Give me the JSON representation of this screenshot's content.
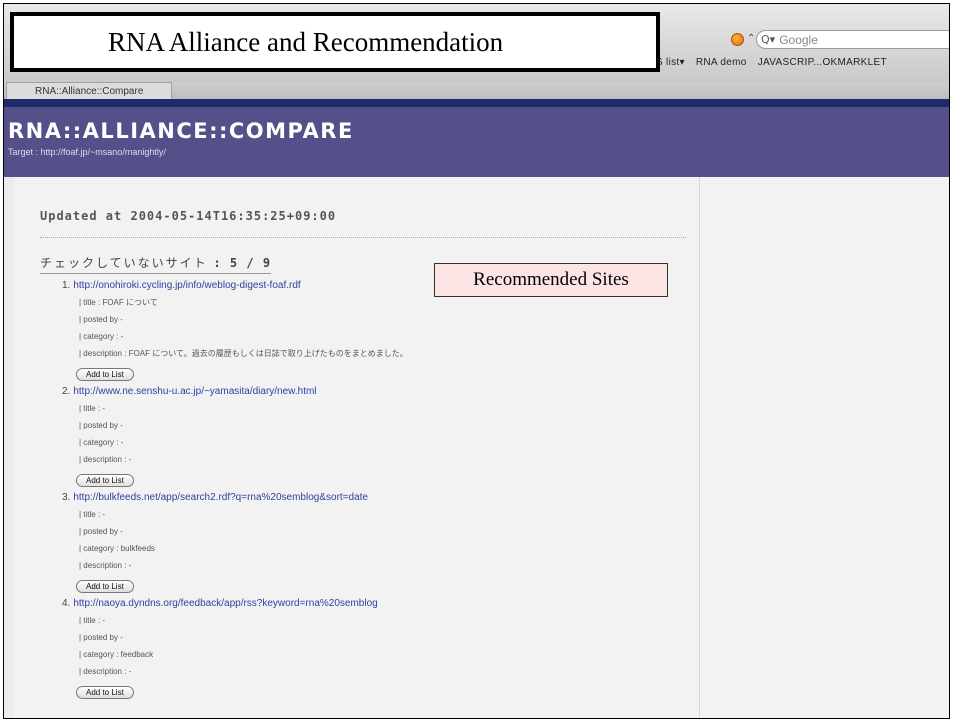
{
  "annotation": {
    "title": "RNA Alliance and Recommendation",
    "recommended": "Recommended Sites"
  },
  "browser": {
    "search_placeholder": "Google",
    "bookmarks": [
      "S list▾",
      "RNA demo",
      "JAVASCRIP...OKMARKLET"
    ],
    "tab_title": "RNA::Alliance::Compare"
  },
  "header": {
    "title": "RNA::ALLIANCE::COMPARE",
    "target": "Target : http://foaf.jp/~msano/manightly/"
  },
  "main": {
    "updated": "Updated at 2004-05-14T16:35:25+09:00",
    "unchecked_label": "チェックしていないサイト",
    "unchecked_count": ": 5 / 9",
    "add_label": "Add to List",
    "entries": [
      {
        "num": "1.",
        "url": "http://onohiroki.cycling.jp/info/weblog-digest-foaf.rdf",
        "title": "| title : FOAF について",
        "posted": "| posted by -",
        "category": "| category : -",
        "description": "| description : FOAF について。過去の履歴もしくは日誌で取り上げたものをまとめました。"
      },
      {
        "num": "2.",
        "url": "http://www.ne.senshu-u.ac.jp/~yamasita/diary/new.html",
        "title": "| title : -",
        "posted": "| posted by -",
        "category": "| category : -",
        "description": "| description : -"
      },
      {
        "num": "3.",
        "url": "http://bulkfeeds.net/app/search2.rdf?q=rna%20semblog&sort=date",
        "title": "| title : -",
        "posted": "| posted by -",
        "category": "| category : bulkfeeds",
        "description": "| description : -"
      },
      {
        "num": "4.",
        "url": "http://naoya.dyndns.org/feedback/app/rss?keyword=rna%20semblog",
        "title": "| title : -",
        "posted": "| posted by -",
        "category": "| category : feedback",
        "description": "| description : -"
      }
    ]
  }
}
